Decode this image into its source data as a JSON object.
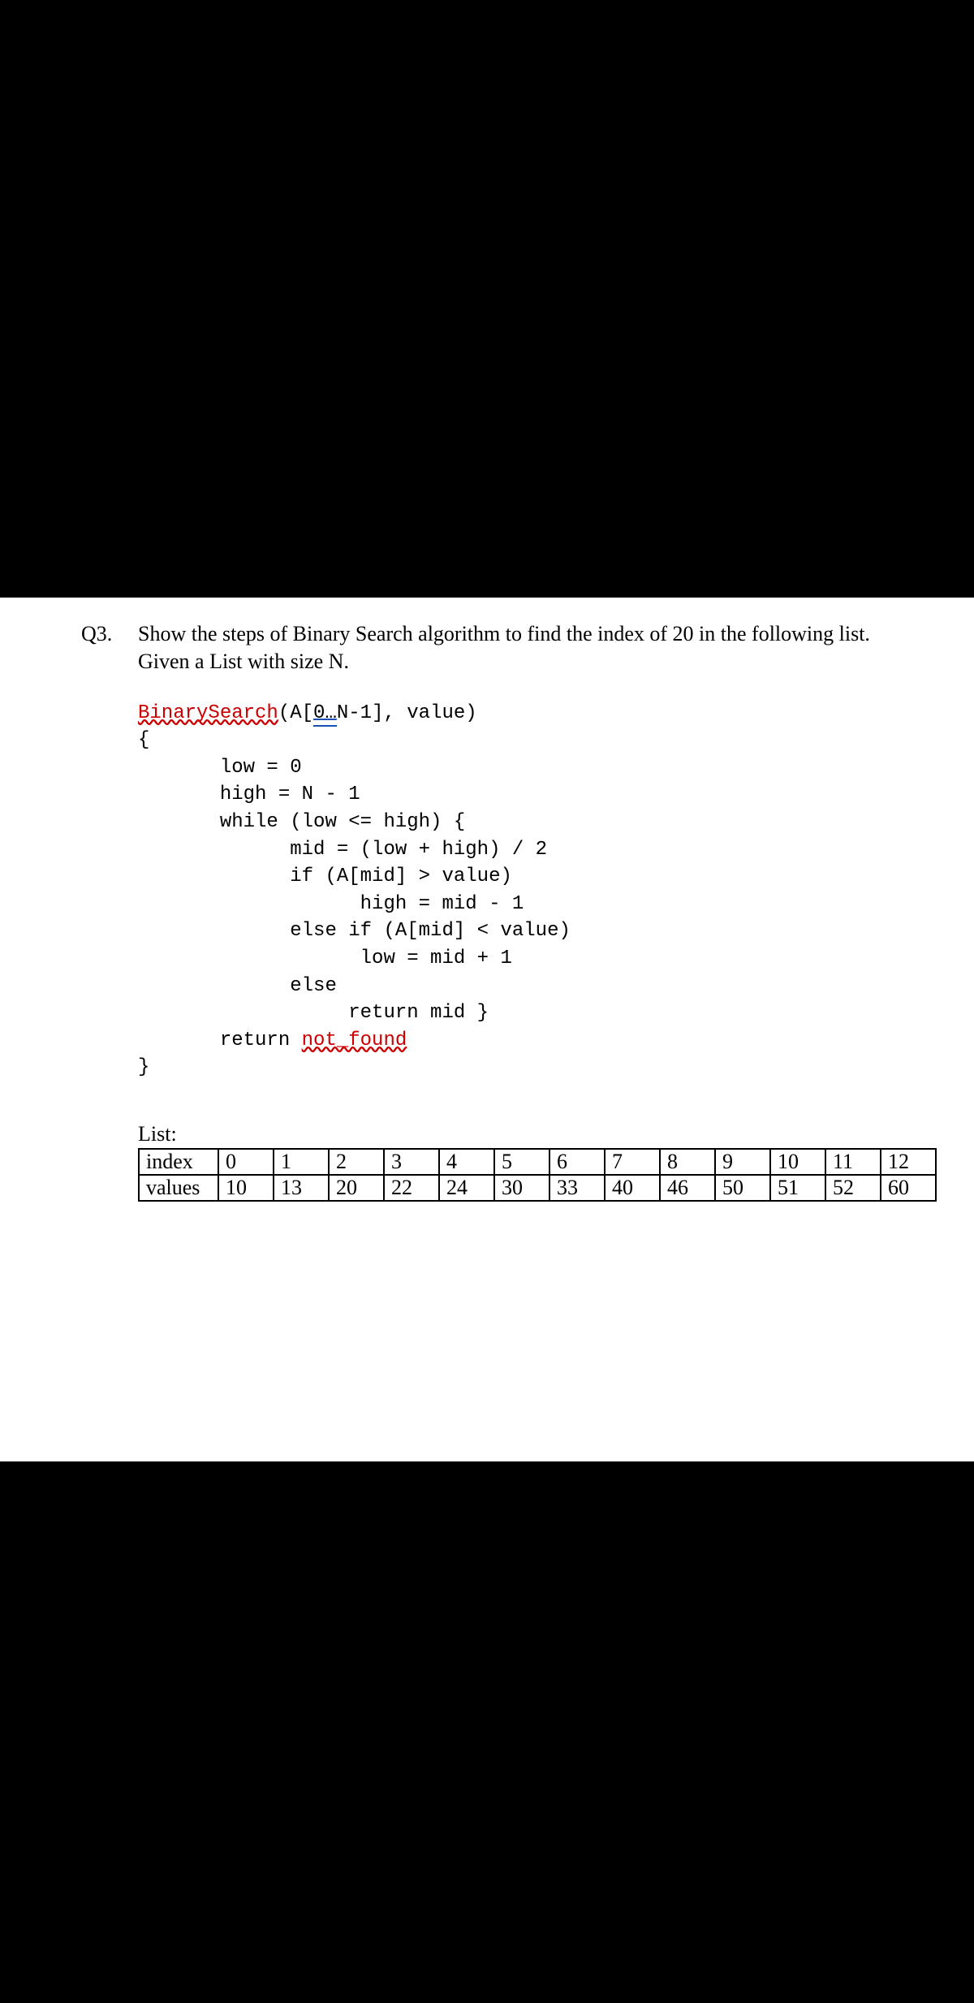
{
  "question": {
    "number": "Q3.",
    "prompt_line1": "Show the steps of Binary Search algorithm to find the index of 20 in the following list.",
    "prompt_line2": "Given a List with size N."
  },
  "code": {
    "fn_name": "BinarySearch",
    "sig_open": "(A[",
    "sig_range": "0…",
    "sig_close": "N-1], value)",
    "l_brace": "{",
    "l1": "       low = 0",
    "l2": "       high = N - 1",
    "l3": "       while (low <= high) {",
    "l4": "             mid = (low + high) / 2",
    "l5": "             if (A[mid] > value)",
    "l6": "                   high = mid - 1",
    "l7": "             else if (A[mid] < value)",
    "l8": "                   low = mid + 1",
    "l9": "             else",
    "l10": "                  return mid }",
    "l11a": "       return ",
    "l11b": "not_found",
    "r_brace": "}"
  },
  "list_label": "List:",
  "table": {
    "row1_label": "index",
    "row2_label": "values",
    "indices": [
      "0",
      "1",
      "2",
      "3",
      "4",
      "5",
      "6",
      "7",
      "8",
      "9",
      "10",
      "11",
      "12"
    ],
    "values": [
      "10",
      "13",
      "20",
      "22",
      "24",
      "30",
      "33",
      "40",
      "46",
      "50",
      "51",
      "52",
      "60"
    ]
  }
}
